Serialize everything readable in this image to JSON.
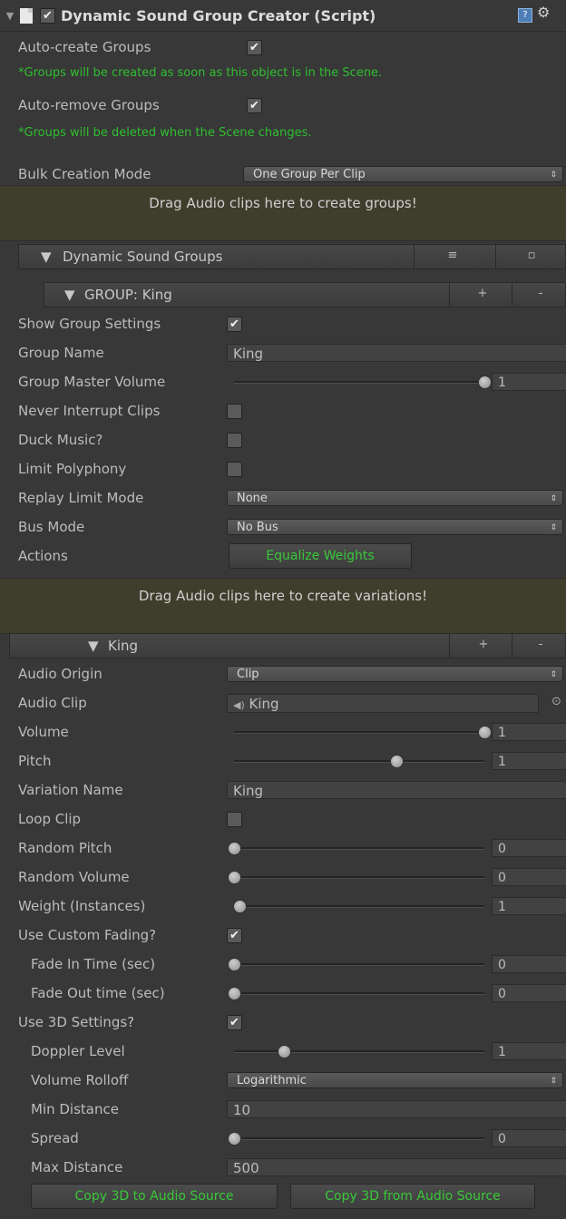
{
  "header": {
    "title": "Dynamic Sound Group Creator (Script)",
    "help_icon": "help-book-icon",
    "gear_icon": "gear-icon",
    "component_icon": "script-file-icon"
  },
  "top": {
    "auto_create_label": "Auto-create Groups",
    "auto_create_note": "*Groups will be created as soon as this object is in the Scene.",
    "auto_remove_label": "Auto-remove Groups",
    "auto_remove_note": "*Groups will be deleted when the Scene changes.",
    "bulk_label": "Bulk Creation Mode",
    "bulk_value": "One Group Per Clip",
    "drop_groups": "Drag Audio clips here to create groups!"
  },
  "groups_bar": {
    "title": "Dynamic Sound Groups",
    "btn1": "≡",
    "btn2": "▫"
  },
  "group": {
    "title": "GROUP: King",
    "plus": "+",
    "minus": "-",
    "show_settings": "Show Group Settings",
    "name_label": "Group Name",
    "name_value": "King",
    "master_vol_label": "Group Master Volume",
    "master_vol_value": "1",
    "never_interrupt": "Never Interrupt Clips",
    "duck_music": "Duck Music?",
    "limit_poly": "Limit Polyphony",
    "replay_label": "Replay Limit Mode",
    "replay_value": "None",
    "bus_label": "Bus Mode",
    "bus_value": "No Bus",
    "actions_label": "Actions",
    "equalize": "Equalize Weights",
    "drop_variations": "Drag Audio clips here to create variations!"
  },
  "variation": {
    "title": "King",
    "plus": "+",
    "minus": "-",
    "origin_label": "Audio Origin",
    "origin_value": "Clip",
    "clip_label": "Audio Clip",
    "clip_value": "King",
    "volume_label": "Volume",
    "volume_value": "1",
    "pitch_label": "Pitch",
    "pitch_value": "1",
    "var_name_label": "Variation Name",
    "var_name_value": "King",
    "loop_label": "Loop Clip",
    "rand_pitch_label": "Random Pitch",
    "rand_pitch_value": "0",
    "rand_vol_label": "Random Volume",
    "rand_vol_value": "0",
    "weight_label": "Weight (Instances)",
    "weight_value": "1",
    "custom_fade_label": "Use Custom Fading?",
    "fade_in_label": "Fade In Time (sec)",
    "fade_in_value": "0",
    "fade_out_label": "Fade Out time (sec)",
    "fade_out_value": "0",
    "use_3d_label": "Use 3D Settings?",
    "doppler_label": "Doppler Level",
    "doppler_value": "1",
    "rolloff_label": "Volume Rolloff",
    "rolloff_value": "Logarithmic",
    "min_dist_label": "Min Distance",
    "min_dist_value": "10",
    "spread_label": "Spread",
    "spread_value": "0",
    "max_dist_label": "Max Distance",
    "max_dist_value": "500",
    "copy_to": "Copy 3D to Audio Source",
    "copy_from": "Copy 3D from Audio Source"
  },
  "sliders": {
    "master_volume": 1,
    "volume": 1,
    "pitch": 0.65,
    "random_pitch": 0,
    "random_volume": 0,
    "weight": 0.02,
    "fade_in": 0,
    "fade_out": 0,
    "doppler": 0.2,
    "spread": 0
  },
  "colors": {
    "panel_bg": "#383838",
    "note_green": "#2fbf2f",
    "dropzone_bg": "#3f3d2c"
  }
}
